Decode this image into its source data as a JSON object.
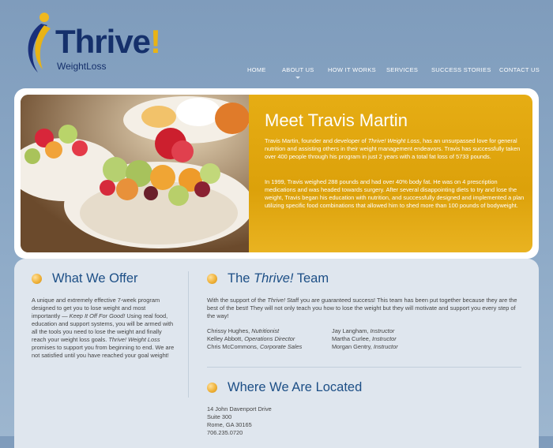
{
  "logo": {
    "word": "Thrive",
    "bang": "!",
    "tagline": "WeightLoss"
  },
  "nav": {
    "items": [
      {
        "label": "HOME"
      },
      {
        "label": "ABOUT US"
      },
      {
        "label": "HOW IT WORKS"
      },
      {
        "label": "SERVICES"
      },
      {
        "label": "SUCCESS STORIES"
      },
      {
        "label": "CONTACT US"
      }
    ],
    "active_item": "ABOUT US"
  },
  "hero": {
    "title": "Meet Travis Martin",
    "p1_a": "Travis Martin, founder and developer of ",
    "p1_em": "Thrive! Weight Loss",
    "p1_b": ", has an unsurpassed love for general nutrition and assisting others in their weight management endeavors. Travis has successfully taken over 400 people through his program in just 2 years with a total fat loss of 5733 pounds.",
    "p2": "In 1999, Travis weighed 288 pounds and had over 40% body fat. He was on 4 prescription medications and was headed towards surgery. After several disappointing diets to try and lose the weight, Travis began his education with nutrition, and successfully designed and implemented a plan utilizing specific food combinations that allowed him to shed more than 100 pounds of bodyweight."
  },
  "offer": {
    "title": "What We Offer",
    "text_a": "A unique and extremely effective 7-week program designed to get you to lose weight and most importantly — ",
    "text_em1": "Keep It Off For Good!",
    "text_b": " Using real food, education and support systems, you will be armed with all the tools you need to lose the weight and finally reach your weight loss goals. ",
    "text_em2": "Thrive! Weight Loss",
    "text_c": " promises to support you from beginning to end. We are not satisfied until you have reached your goal weight!"
  },
  "team": {
    "title_a": "The ",
    "title_em": "Thrive!",
    "title_b": " Team",
    "intro_a": "With the support of the ",
    "intro_em": "Thrive!",
    "intro_b": " Staff you are guaranteed success! This team has been put together because they are the best of the best! They will not only teach you how to lose the weight but they will motivate and support you every step of the way!",
    "members_left": [
      {
        "name": "Chrissy Hughes, ",
        "role": "Nutritionist"
      },
      {
        "name": "Kelley Abbott, ",
        "role": "Operations Director"
      },
      {
        "name": "Chris McCommons, ",
        "role": "Corporate Sales"
      }
    ],
    "members_right": [
      {
        "name": "Jay Langham, ",
        "role": "Instructor"
      },
      {
        "name": "Martha Curlee, ",
        "role": "Instructor"
      },
      {
        "name": "Morgan Gentry, ",
        "role": "Instructor"
      }
    ]
  },
  "location": {
    "title": "Where We Are Located",
    "lines": [
      "14 John Davenport Drive",
      "Suite 300",
      "Rome, GA 30165",
      "706.235.0720"
    ]
  },
  "colors": {
    "accent": "#dca10a",
    "heading": "#1d4f86",
    "brand_navy": "#15306b",
    "brand_gold": "#e9b314"
  },
  "icons": {
    "section_bullet": "orange-bullet-icon",
    "logo_mark": "swoosh-icon"
  }
}
